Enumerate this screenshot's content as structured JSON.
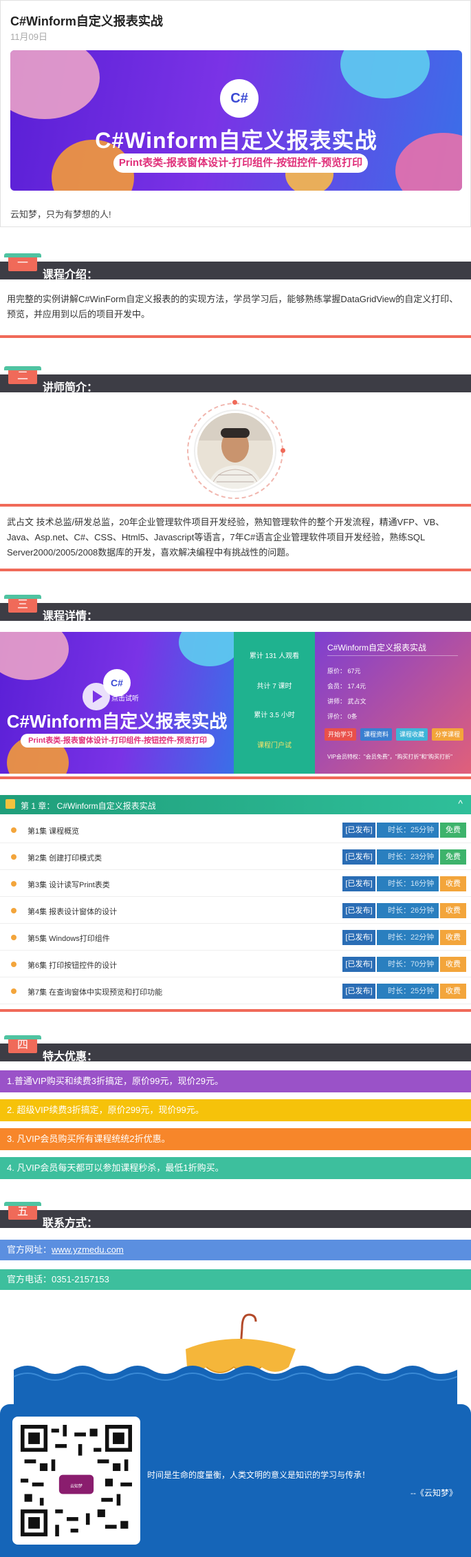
{
  "header": {
    "title": "C#Winform自定义报表实战",
    "date": "11月09日",
    "banner_badge": "C#",
    "banner_title": "C#Winform自定义报表实战",
    "banner_subtitle": "Print表类-报表窗体设计-打印组件-按钮控件-预览打印",
    "motto": "云知梦，只为有梦想的人!"
  },
  "sections": {
    "s1": {
      "num": "一",
      "label": "课程介绍："
    },
    "s2": {
      "num": "二",
      "label": "讲师简介："
    },
    "s3": {
      "num": "三",
      "label": "课程详情："
    },
    "s4": {
      "num": "四",
      "label": "特大优惠："
    },
    "s5": {
      "num": "五",
      "label": "联系方式："
    }
  },
  "intro": "用完整的实例讲解C#WinForm自定义报表的的实现方法，学员学习后，能够熟练掌握DataGridView的自定义打印、预览，并应用到以后的项目开发中。",
  "teacher": "武占文 技术总监/研发总监，20年企业管理软件项目开发经验，熟知管理软件的整个开发流程，精通VFP、VB、Java、Asp.net、C#、CSS、Html5、Javascript等语言，7年C#语言企业管理软件项目开发经验，熟练SQL Server2000/2005/2008数据库的开发，喜欢解决编程中有挑战性的问题。",
  "detail": {
    "badge": "C#",
    "title": "C#Winform自定义报表实战",
    "subtitle": "Print表类-报表窗体设计-打印组件-按钮控件-预览打印",
    "play_label": "点击试听",
    "stat1": "累计 131 人观看",
    "stat2": "共计 7 课时",
    "stat3": "累计 3.5 小时",
    "stat4": "课程门户试",
    "card_title": "C#Winform自定义报表实战",
    "row1": "原价：  67元",
    "row2": "会员：  17.4元",
    "row3": "讲师：  武占文",
    "row4": "评价：  0条",
    "btn1": "开始学习",
    "btn2": "课程资料",
    "btn3": "课程收藏",
    "btn4": "分享课程",
    "note": "VIP会员特权：\"会员免费\"，\"购买打折\"和\"购买打折\""
  },
  "chapter": {
    "title": "第 1 章：   C#Winform自定义报表实战",
    "arrow": "^"
  },
  "lessons": [
    {
      "title": "第1集 课程概览",
      "status": "[已发布]",
      "duration": "时长：25分钟",
      "fee": "免费",
      "fee_color": "#3db36b"
    },
    {
      "title": "第2集 创建打印模式类",
      "status": "[已发布]",
      "duration": "时长：23分钟",
      "fee": "免费",
      "fee_color": "#3db36b"
    },
    {
      "title": "第3集 设计读写Print表类",
      "status": "[已发布]",
      "duration": "时长：16分钟",
      "fee": "收费",
      "fee_color": "#f3a53b"
    },
    {
      "title": "第4集 报表设计窗体的设计",
      "status": "[已发布]",
      "duration": "时长：26分钟",
      "fee": "收费",
      "fee_color": "#f3a53b"
    },
    {
      "title": "第5集 Windows打印组件",
      "status": "[已发布]",
      "duration": "时长：22分钟",
      "fee": "收费",
      "fee_color": "#f3a53b"
    },
    {
      "title": "第6集 打印按钮控件的设计",
      "status": "[已发布]",
      "duration": "时长：70分钟",
      "fee": "收费",
      "fee_color": "#f3a53b"
    },
    {
      "title": "第7集 在查询窗体中实现预览和打印功能",
      "status": "[已发布]",
      "duration": "时长：25分钟",
      "fee": "收费",
      "fee_color": "#f3a53b"
    }
  ],
  "offers": [
    {
      "text": "1.普通VIP购买和续费3折搞定，原价99元，现价29元。",
      "color": "#9a52c8"
    },
    {
      "text": "2. 超级VIP续费3折搞定，原价299元，现价99元。",
      "color": "#f6c20a"
    },
    {
      "text": "3. 凡VIP会员购买所有课程统统2折优惠。",
      "color": "#f7862a"
    },
    {
      "text": "4. 凡VIP会员每天都可以参加课程秒杀，最低1折购买。",
      "color": "#3dbf9d"
    }
  ],
  "contact": {
    "site_label": "官方网址：",
    "site_url": "www.yzmedu.com",
    "site_color": "#5b8fe0",
    "phone": "官方电话：0351-2157153",
    "phone_color": "#3dbf9d"
  },
  "footer": {
    "logo_text": "云知梦",
    "quote": "时间是生命的度量衡，人类文明的意义是知识的学习与传承！",
    "sign": "--《云知梦》"
  }
}
